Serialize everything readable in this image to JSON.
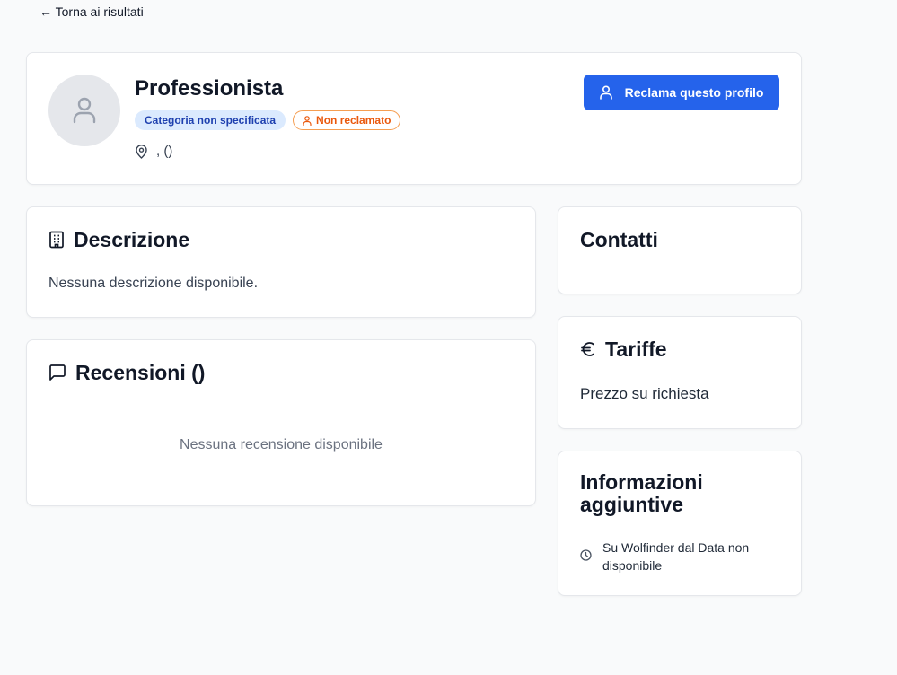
{
  "nav": {
    "back_label": "← Torna ai risultati"
  },
  "profile": {
    "name": "Professionista",
    "category_badge": "Categoria non specificata",
    "status_badge": "Non reclamato",
    "location": ", ()",
    "claim_button": "Reclama questo profilo"
  },
  "description": {
    "title": "Descrizione",
    "text": "Nessuna descrizione disponibile."
  },
  "reviews": {
    "title": "Recensioni ()",
    "empty_text": "Nessuna recensione disponibile"
  },
  "contacts": {
    "title": "Contatti"
  },
  "rates": {
    "title": "Tariffe",
    "text": "Prezzo su richiesta"
  },
  "additional_info": {
    "title": "Informazioni aggiuntive",
    "since_text": "Su Wolfinder dal Data non disponibile"
  },
  "icons": {
    "avatar": "user-icon",
    "claim": "user-icon",
    "status": "user-icon",
    "location": "map-pin-icon",
    "description": "building-icon",
    "reviews": "message-square-icon",
    "rates": "euro-icon",
    "info": "clock-icon"
  },
  "colors": {
    "primary": "#2563eb",
    "category_badge_bg": "#dbeafe",
    "category_badge_text": "#1e40af",
    "status_badge": "#ea580c",
    "background": "#f9fafb"
  }
}
